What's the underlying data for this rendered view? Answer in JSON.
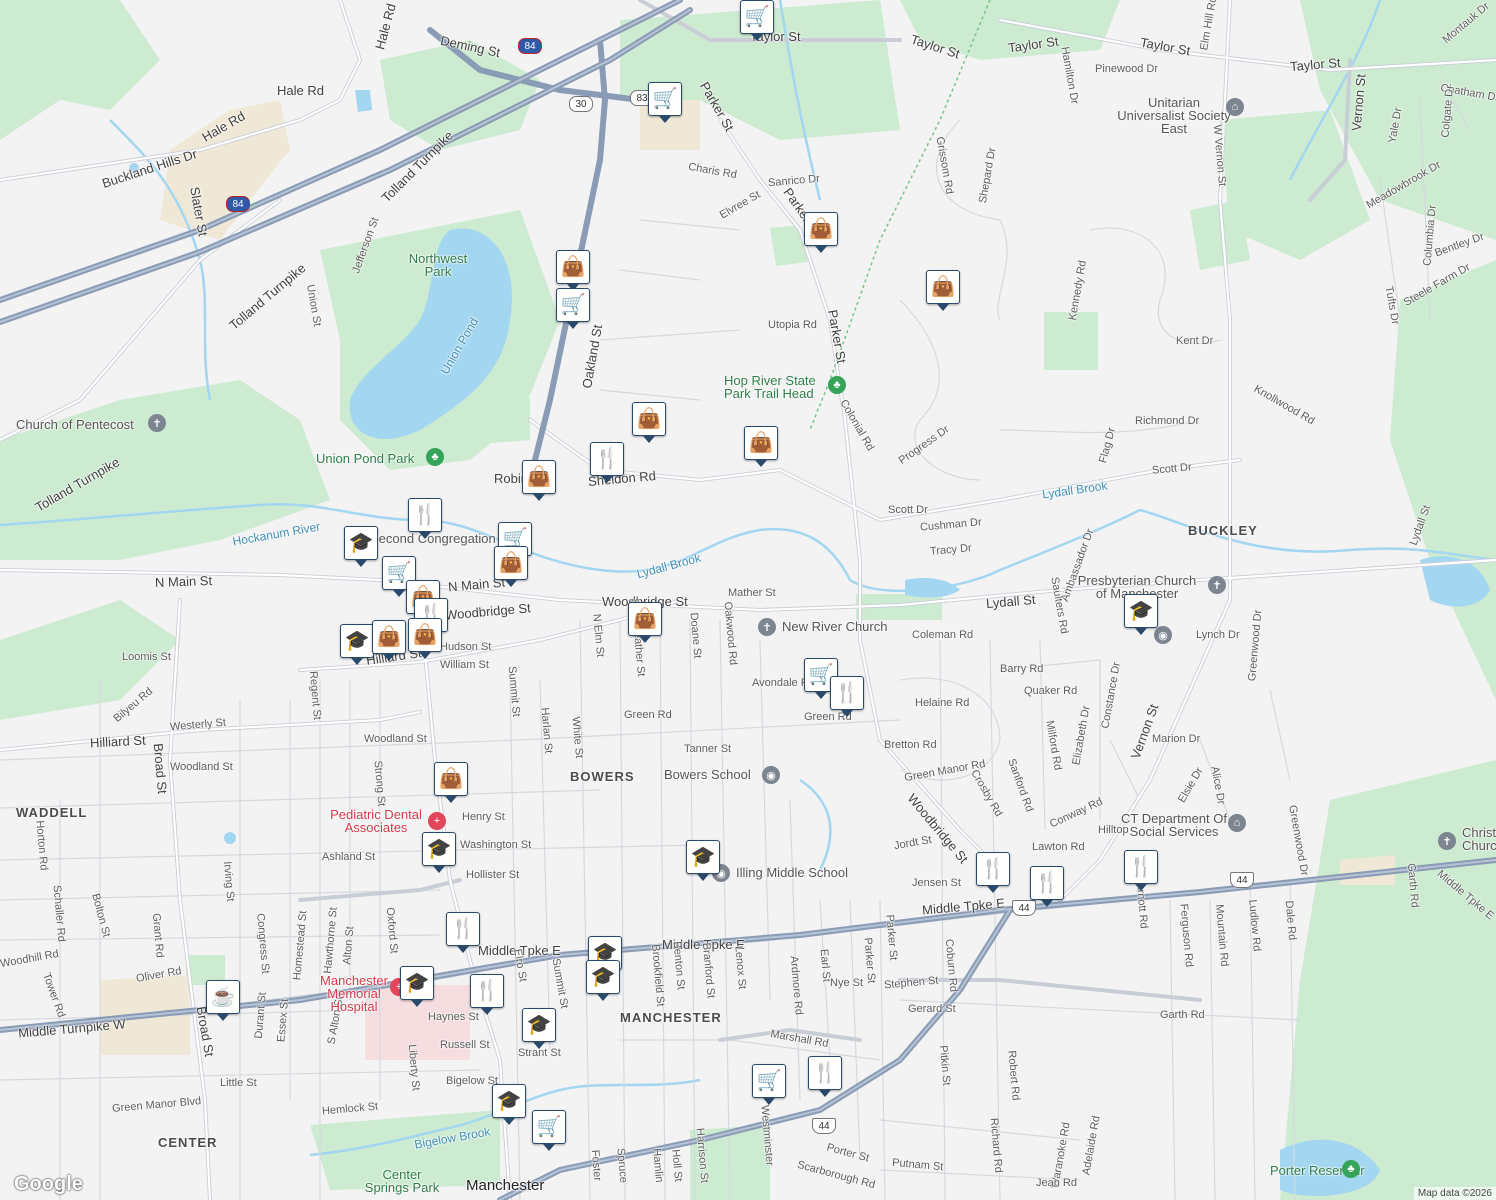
{
  "map": {
    "attribution": "Map data ©2026",
    "logo": "Google",
    "colors": {
      "background": "#f3f3f4",
      "park": "#cdebd0",
      "road": "#ffffff",
      "road_outline": "#c9ced6",
      "highway": "#8a9bb5",
      "water": "#a3d6f0",
      "pin": "#123a5e"
    }
  },
  "streets": [
    {
      "id": "st1",
      "text": "Deming St"
    },
    {
      "id": "st2",
      "text": "Hale Rd"
    },
    {
      "id": "st3",
      "text": "Hale Rd"
    },
    {
      "id": "st4",
      "text": "Hale Rd"
    },
    {
      "id": "st5",
      "text": "Buckland Hills Dr"
    },
    {
      "id": "st6",
      "text": "Slater St"
    },
    {
      "id": "st7",
      "text": "Tolland Turnpike"
    },
    {
      "id": "st8",
      "text": "Tolland Turnpike"
    },
    {
      "id": "st9",
      "text": "Tolland Turnpike"
    },
    {
      "id": "st10",
      "text": "Jefferson St"
    },
    {
      "id": "st11",
      "text": "Union St"
    },
    {
      "id": "st12",
      "text": "Taylor St"
    },
    {
      "id": "st13",
      "text": "Taylor St"
    },
    {
      "id": "st14",
      "text": "Taylor St"
    },
    {
      "id": "st15",
      "text": "Taylor St"
    },
    {
      "id": "st16",
      "text": "Taylor St"
    },
    {
      "id": "st17",
      "text": "Parker St"
    },
    {
      "id": "st18",
      "text": "Parker St"
    },
    {
      "id": "st19",
      "text": "Parker St"
    },
    {
      "id": "st20",
      "text": "Charis Rd"
    },
    {
      "id": "st21",
      "text": "Sanrico Dr"
    },
    {
      "id": "st22",
      "text": "Elvree St"
    },
    {
      "id": "st23",
      "text": "Oakland St"
    },
    {
      "id": "st24",
      "text": "Utopia Rd"
    },
    {
      "id": "st25",
      "text": "Colonial Rd"
    },
    {
      "id": "st26",
      "text": "Progress Dr"
    },
    {
      "id": "st27",
      "text": "Grissom Rd"
    },
    {
      "id": "st28",
      "text": "Shepard Dr"
    },
    {
      "id": "st29",
      "text": "Pinewood Dr"
    },
    {
      "id": "st30",
      "text": "Hamilton Dr"
    },
    {
      "id": "st31",
      "text": "Elm Hill Rd"
    },
    {
      "id": "st32",
      "text": "W Vernon St"
    },
    {
      "id": "st33",
      "text": "Kennedy Rd"
    },
    {
      "id": "st34",
      "text": "Kent Dr"
    },
    {
      "id": "st35",
      "text": "Richmond Dr"
    },
    {
      "id": "st36",
      "text": "Knollwood Rd"
    },
    {
      "id": "st37",
      "text": "Scott Dr"
    },
    {
      "id": "st38",
      "text": "Scott Dr"
    },
    {
      "id": "st39",
      "text": "Flag Dr"
    },
    {
      "id": "st40",
      "text": "Cushman Dr"
    },
    {
      "id": "st41",
      "text": "Tracy Dr"
    },
    {
      "id": "st42",
      "text": "Ambassador Dr"
    },
    {
      "id": "st43",
      "text": "Lydall St"
    },
    {
      "id": "st44",
      "text": "Lydall St"
    },
    {
      "id": "st45",
      "text": "Vernon St"
    },
    {
      "id": "st46",
      "text": "Vernon St"
    },
    {
      "id": "st47",
      "text": "Montauk Dr"
    },
    {
      "id": "st48",
      "text": "Chatham Dr"
    },
    {
      "id": "st49",
      "text": "Colgate Dr"
    },
    {
      "id": "st50",
      "text": "Yale Dr"
    },
    {
      "id": "st51",
      "text": "Meadowbrook Dr"
    },
    {
      "id": "st52",
      "text": "Columbia Dr"
    },
    {
      "id": "st53",
      "text": "Bentley Dr"
    },
    {
      "id": "st54",
      "text": "Tufts Dr"
    },
    {
      "id": "st55",
      "text": "Steele Farm Dr"
    },
    {
      "id": "st56",
      "text": "Sheldon Rd"
    },
    {
      "id": "st57",
      "text": "N Main St"
    },
    {
      "id": "st58",
      "text": "N Main St"
    },
    {
      "id": "st59",
      "text": "Woodbridge St"
    },
    {
      "id": "st60",
      "text": "Woodbridge St"
    },
    {
      "id": "st61",
      "text": "Mather St"
    },
    {
      "id": "st62",
      "text": "Coleman Rd"
    },
    {
      "id": "st63",
      "text": "Lynch Dr"
    },
    {
      "id": "st64",
      "text": "Saulters Rd"
    },
    {
      "id": "st65",
      "text": "Barry Rd"
    },
    {
      "id": "st66",
      "text": "Quaker Rd"
    },
    {
      "id": "st67",
      "text": "Helaine Rd"
    },
    {
      "id": "st68",
      "text": "Bretton Rd"
    },
    {
      "id": "st69",
      "text": "Marion Dr"
    },
    {
      "id": "st70",
      "text": "Constance Dr"
    },
    {
      "id": "st71",
      "text": "Elizabeth Dr"
    },
    {
      "id": "st72",
      "text": "Milford Rd"
    },
    {
      "id": "st73",
      "text": "Green Manor Rd"
    },
    {
      "id": "st74",
      "text": "Sanford Rd"
    },
    {
      "id": "st75",
      "text": "Crosby Rd"
    },
    {
      "id": "st76",
      "text": "Conway Rd"
    },
    {
      "id": "st77",
      "text": "Elsie Dr"
    },
    {
      "id": "st78",
      "text": "Alice Dr"
    },
    {
      "id": "st79",
      "text": "Greenwood Dr"
    },
    {
      "id": "st80",
      "text": "Greenwood Dr"
    },
    {
      "id": "st81",
      "text": "Lawton Rd"
    },
    {
      "id": "st82",
      "text": "Hilltop"
    },
    {
      "id": "st83",
      "text": "Jensen St"
    },
    {
      "id": "st84",
      "text": "Jordt St"
    },
    {
      "id": "st85",
      "text": "Woodbridge St"
    },
    {
      "id": "st86",
      "text": "Avondale Rd"
    },
    {
      "id": "st87",
      "text": "Green Rd"
    },
    {
      "id": "st88",
      "text": "Green Rd"
    },
    {
      "id": "st89",
      "text": "Tanner St"
    },
    {
      "id": "st90",
      "text": "Oakwood Rd"
    },
    {
      "id": "st91",
      "text": "Doane St"
    },
    {
      "id": "st92",
      "text": "Starkweather St"
    },
    {
      "id": "st93",
      "text": "N Elm St"
    },
    {
      "id": "st94",
      "text": "White St"
    },
    {
      "id": "st95",
      "text": "Harlan St"
    },
    {
      "id": "st96",
      "text": "Summit St"
    },
    {
      "id": "st97",
      "text": "Hudson St"
    },
    {
      "id": "st98",
      "text": "William St"
    },
    {
      "id": "st99",
      "text": "Loomis St"
    },
    {
      "id": "st100",
      "text": "Hilliard St"
    },
    {
      "id": "st101",
      "text": "Hilliard St"
    },
    {
      "id": "st102",
      "text": "Bilyeu Rd"
    },
    {
      "id": "st103",
      "text": "Westerly St"
    },
    {
      "id": "st104",
      "text": "Woodland St"
    },
    {
      "id": "st105",
      "text": "Woodland St"
    },
    {
      "id": "st106",
      "text": "Regent St"
    },
    {
      "id": "st107",
      "text": "Strong St"
    },
    {
      "id": "st108",
      "text": "Broad St"
    },
    {
      "id": "st109",
      "text": "Broad St"
    },
    {
      "id": "st110",
      "text": "Henry St"
    },
    {
      "id": "st111",
      "text": "Washington St"
    },
    {
      "id": "st112",
      "text": "Ashland St"
    },
    {
      "id": "st113",
      "text": "Hollister St"
    },
    {
      "id": "st114",
      "text": "Middle Tpke E"
    },
    {
      "id": "st115",
      "text": "Middle Tpke E"
    },
    {
      "id": "st116",
      "text": "Middle Tpke E"
    },
    {
      "id": "st117",
      "text": "Middle Turnpike W"
    },
    {
      "id": "st118",
      "text": "Oliver Rd"
    },
    {
      "id": "st119",
      "text": "Grant Rd"
    },
    {
      "id": "st120",
      "text": "Bolton St"
    },
    {
      "id": "st121",
      "text": "Horton Rd"
    },
    {
      "id": "st122",
      "text": "Schaller Rd"
    },
    {
      "id": "st123",
      "text": "Irving St"
    },
    {
      "id": "st124",
      "text": "Congress St"
    },
    {
      "id": "st125",
      "text": "Homestead St"
    },
    {
      "id": "st126",
      "text": "Hawthorne St"
    },
    {
      "id": "st127",
      "text": "Alton St"
    },
    {
      "id": "st128",
      "text": "Oxford St"
    },
    {
      "id": "st129",
      "text": "Durant St"
    },
    {
      "id": "st130",
      "text": "Essex St"
    },
    {
      "id": "st131",
      "text": "S Alton St"
    },
    {
      "id": "st132",
      "text": "Liberty St"
    },
    {
      "id": "st133",
      "text": "Little St"
    },
    {
      "id": "st134",
      "text": "Green Manor Blvd"
    },
    {
      "id": "st135",
      "text": "Hemlock St"
    },
    {
      "id": "st136",
      "text": "Bigelow St"
    },
    {
      "id": "st137",
      "text": "Russell St"
    },
    {
      "id": "st138",
      "text": "Haynes St"
    },
    {
      "id": "st139",
      "text": "Strant St"
    },
    {
      "id": "st140",
      "text": "Elro St"
    },
    {
      "id": "st141",
      "text": "Summit St"
    },
    {
      "id": "st142",
      "text": "Brookfield St"
    },
    {
      "id": "st143",
      "text": "Benton St"
    },
    {
      "id": "st144",
      "text": "Branford St"
    },
    {
      "id": "st145",
      "text": "Lenox St"
    },
    {
      "id": "st146",
      "text": "Ardmore Rd"
    },
    {
      "id": "st147",
      "text": "Earl St"
    },
    {
      "id": "st148",
      "text": "Parker St"
    },
    {
      "id": "st149",
      "text": "Nye St"
    },
    {
      "id": "st150",
      "text": "Stephen St"
    },
    {
      "id": "st151",
      "text": "Coburn Rd"
    },
    {
      "id": "st152",
      "text": "Gerard St"
    },
    {
      "id": "st153",
      "text": "Garth Rd"
    },
    {
      "id": "st154",
      "text": "Ferguson Rd"
    },
    {
      "id": "st155",
      "text": "Mountain Rd"
    },
    {
      "id": "st156",
      "text": "Ludlow Rd"
    },
    {
      "id": "st157",
      "text": "Dale Rd"
    },
    {
      "id": "st158",
      "text": "Arnott Rd"
    },
    {
      "id": "st159",
      "text": "Garth Rd"
    },
    {
      "id": "st160",
      "text": "Middle Tpke E"
    },
    {
      "id": "st161",
      "text": "Marshall Rd"
    },
    {
      "id": "st162",
      "text": "Pitkin St"
    },
    {
      "id": "st163",
      "text": "Robert Rd"
    },
    {
      "id": "st164",
      "text": "Richard Rd"
    },
    {
      "id": "st165",
      "text": "Waranoke Rd"
    },
    {
      "id": "st166",
      "text": "Adelaide Rd"
    },
    {
      "id": "st167",
      "text": "Jean Rd"
    },
    {
      "id": "st168",
      "text": "Porter St"
    },
    {
      "id": "st169",
      "text": "Putnam St"
    },
    {
      "id": "st170",
      "text": "Scarborough Rd"
    },
    {
      "id": "st171",
      "text": "Westminster"
    },
    {
      "id": "st172",
      "text": "Harrison St"
    },
    {
      "id": "st173",
      "text": "Hamlin"
    },
    {
      "id": "st174",
      "text": "Holl St"
    },
    {
      "id": "st175",
      "text": "Spruce"
    },
    {
      "id": "st176",
      "text": "Foster"
    },
    {
      "id": "st177",
      "text": "Tower Rd"
    },
    {
      "id": "st178",
      "text": "Woodhill Rd"
    },
    {
      "id": "st179",
      "text": "Robinson"
    },
    {
      "id": "st180",
      "text": "Parker St"
    }
  ],
  "places": [
    {
      "id": "p1",
      "text": "Northwest Park",
      "kind": "park"
    },
    {
      "id": "p2",
      "text": "Union Pond",
      "kind": "water"
    },
    {
      "id": "p3",
      "text": "Church of Pentecost",
      "kind": "poi"
    },
    {
      "id": "p4",
      "text": "Union Pond Park",
      "kind": "park"
    },
    {
      "id": "p5",
      "text": "Hockanum River",
      "kind": "water"
    },
    {
      "id": "p6",
      "text": "Second Congregation",
      "kind": "poi"
    },
    {
      "id": "p7",
      "text": "Hop River State Park Trail Head",
      "kind": "park"
    },
    {
      "id": "p8",
      "text": "Lydall Brook",
      "kind": "water"
    },
    {
      "id": "p9",
      "text": "Lydall Brook",
      "kind": "water"
    },
    {
      "id": "p10",
      "text": "Unitarian Universalist Society East",
      "kind": "poi"
    },
    {
      "id": "p11",
      "text": "BUCKLEY",
      "kind": "area"
    },
    {
      "id": "p12",
      "text": "Presbyterian Church of Manchester",
      "kind": "poi"
    },
    {
      "id": "p13",
      "text": "New River Church",
      "kind": "poi"
    },
    {
      "id": "p14",
      "text": "BOWERS",
      "kind": "area"
    },
    {
      "id": "p15",
      "text": "Bowers School",
      "kind": "poi"
    },
    {
      "id": "p16",
      "text": "WADDELL",
      "kind": "area"
    },
    {
      "id": "p17",
      "text": "Pediatric Dental Associates",
      "kind": "med"
    },
    {
      "id": "p18",
      "text": "Illing Middle School",
      "kind": "poi"
    },
    {
      "id": "p19",
      "text": "CT Department Of Social Services",
      "kind": "poi"
    },
    {
      "id": "p20",
      "text": "Christ Church",
      "kind": "poi"
    },
    {
      "id": "p21",
      "text": "Manchester Memorial Hospital",
      "kind": "med"
    },
    {
      "id": "p22",
      "text": "MANCHESTER",
      "kind": "area"
    },
    {
      "id": "p23",
      "text": "CENTER",
      "kind": "area"
    },
    {
      "id": "p24",
      "text": "Bigelow Brook",
      "kind": "water"
    },
    {
      "id": "p25",
      "text": "Center Springs Park",
      "kind": "park"
    },
    {
      "id": "p26",
      "text": "Manchester",
      "kind": "city"
    },
    {
      "id": "p27",
      "text": "Porter Reservoir",
      "kind": "park"
    }
  ],
  "shields": [
    {
      "id": "sh1",
      "text": "84",
      "type": "interstate"
    },
    {
      "id": "sh2",
      "text": "84",
      "type": "interstate"
    },
    {
      "id": "sh3",
      "text": "30",
      "type": "state"
    },
    {
      "id": "sh4",
      "text": "83",
      "type": "state"
    },
    {
      "id": "sh5",
      "text": "44",
      "type": "us"
    },
    {
      "id": "sh6",
      "text": "44",
      "type": "us"
    },
    {
      "id": "sh7",
      "text": "44",
      "type": "us"
    }
  ],
  "markers": [
    {
      "id": "m1",
      "type": "shopping-cart"
    },
    {
      "id": "m2",
      "type": "shopping-cart"
    },
    {
      "id": "m3",
      "type": "shopping-bag"
    },
    {
      "id": "m4",
      "type": "shopping-bag"
    },
    {
      "id": "m5",
      "type": "shopping-cart"
    },
    {
      "id": "m6",
      "type": "shopping-bag"
    },
    {
      "id": "m7",
      "type": "shopping-bag"
    },
    {
      "id": "m8",
      "type": "restaurant"
    },
    {
      "id": "m9",
      "type": "shopping-bag"
    },
    {
      "id": "m10",
      "type": "shopping-bag"
    },
    {
      "id": "m11",
      "type": "restaurant"
    },
    {
      "id": "m12",
      "type": "school"
    },
    {
      "id": "m13",
      "type": "shopping-cart"
    },
    {
      "id": "m14",
      "type": "shopping-bag"
    },
    {
      "id": "m15",
      "type": "shopping-cart"
    },
    {
      "id": "m16",
      "type": "shopping-bag"
    },
    {
      "id": "m17",
      "type": "restaurant"
    },
    {
      "id": "m18",
      "type": "school"
    },
    {
      "id": "m19",
      "type": "shopping-bag"
    },
    {
      "id": "m20",
      "type": "shopping-bag"
    },
    {
      "id": "m21",
      "type": "shopping-bag"
    },
    {
      "id": "m22",
      "type": "shopping-cart"
    },
    {
      "id": "m23",
      "type": "restaurant"
    },
    {
      "id": "m24",
      "type": "school"
    },
    {
      "id": "m25",
      "type": "shopping-bag"
    },
    {
      "id": "m26",
      "type": "school"
    },
    {
      "id": "m27",
      "type": "school"
    },
    {
      "id": "m28",
      "type": "restaurant"
    },
    {
      "id": "m29",
      "type": "restaurant"
    },
    {
      "id": "m30",
      "type": "restaurant"
    },
    {
      "id": "m31",
      "type": "restaurant"
    },
    {
      "id": "m32",
      "type": "school"
    },
    {
      "id": "m33",
      "type": "school"
    },
    {
      "id": "m34",
      "type": "school"
    },
    {
      "id": "m35",
      "type": "cafe"
    },
    {
      "id": "m36",
      "type": "restaurant"
    },
    {
      "id": "m37",
      "type": "school"
    },
    {
      "id": "m38",
      "type": "school"
    },
    {
      "id": "m39",
      "type": "shopping-cart"
    },
    {
      "id": "m40",
      "type": "restaurant"
    },
    {
      "id": "m41",
      "type": "shopping-cart"
    },
    {
      "id": "m42",
      "type": "school"
    }
  ]
}
